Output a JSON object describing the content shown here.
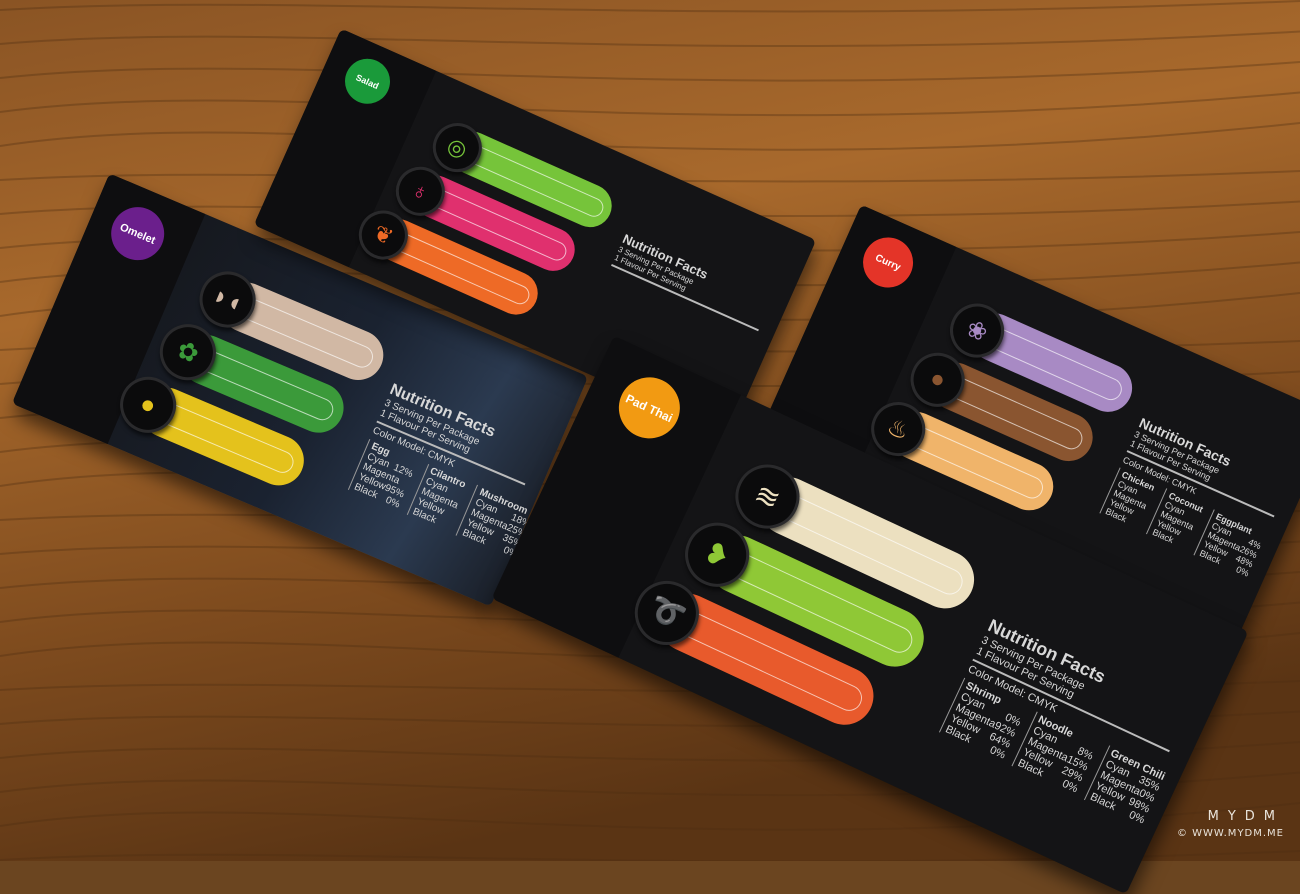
{
  "background": {
    "colors": {
      "wood_light": "#a7692e",
      "wood_mid": "#7a4a1f",
      "wood_dark": "#4a2a10"
    }
  },
  "cards": [
    {
      "id": "omelet",
      "title": "Omelet",
      "badge_color": "#6b1f8c",
      "pills": [
        {
          "color": "#d1b8a4",
          "icon": "mushroom-icon",
          "glyph": "◗◖"
        },
        {
          "color": "#3b9a3a",
          "icon": "herb-icon",
          "glyph": "✿"
        },
        {
          "color": "#e4c21c",
          "icon": "egg-icon",
          "glyph": "●"
        }
      ],
      "facts": {
        "title": "Nutrition Facts",
        "line1": "3 Serving Per Package",
        "line2": "1 Flavour Per Serving",
        "color_model": "Color Model: CMYK",
        "groups": [
          {
            "name": "Egg",
            "rows": [
              [
                "Cyan",
                "12%"
              ],
              [
                "Magenta",
                ""
              ],
              [
                "Yellow",
                "95%"
              ],
              [
                "Black",
                "0%"
              ]
            ]
          },
          {
            "name": "Cilantro",
            "rows": [
              [
                "Cyan",
                ""
              ],
              [
                "Magenta",
                ""
              ],
              [
                "Yellow",
                ""
              ],
              [
                "Black",
                ""
              ]
            ]
          },
          {
            "name": "Mushroom",
            "rows": [
              [
                "Cyan",
                "18%"
              ],
              [
                "Magenta",
                "25%"
              ],
              [
                "Yellow",
                "35%"
              ],
              [
                "Black",
                "0%"
              ]
            ]
          }
        ]
      }
    },
    {
      "id": "salad",
      "title": "Salad",
      "badge_color": "#1a9a3a",
      "pills": [
        {
          "color": "#76c43a",
          "icon": "cucumber-icon",
          "glyph": "◎"
        },
        {
          "color": "#e0306e",
          "icon": "onion-icon",
          "glyph": "♁"
        },
        {
          "color": "#ee6a26",
          "icon": "carrot-icon",
          "glyph": "❦"
        }
      ],
      "facts": {
        "title": "Nutrition Facts",
        "line1": "3 Serving Per Package",
        "line2": "1 Flavour Per Serving",
        "color_model": "",
        "groups": []
      }
    },
    {
      "id": "curry",
      "title": "Curry",
      "badge_color": "#e43428",
      "pills": [
        {
          "color": "#a88ac4",
          "icon": "eggplant-icon",
          "glyph": "❀"
        },
        {
          "color": "#8a5530",
          "icon": "egg-icon",
          "glyph": "●"
        },
        {
          "color": "#f0b46a",
          "icon": "chicken-icon",
          "glyph": "♨"
        }
      ],
      "facts": {
        "title": "Nutrition Facts",
        "line1": "3 Serving Per Package",
        "line2": "1 Flavour Per Serving",
        "color_model": "Color Model: CMYK",
        "groups": [
          {
            "name": "Chicken",
            "rows": [
              [
                "Cyan",
                ""
              ],
              [
                "Magenta",
                ""
              ],
              [
                "Yellow",
                ""
              ],
              [
                "Black",
                ""
              ]
            ]
          },
          {
            "name": "Coconut",
            "rows": [
              [
                "Cyan",
                ""
              ],
              [
                "Magenta",
                ""
              ],
              [
                "Yellow",
                ""
              ],
              [
                "Black",
                ""
              ]
            ]
          },
          {
            "name": "Eggplant",
            "rows": [
              [
                "Cyan",
                "4%"
              ],
              [
                "Magenta",
                "26%"
              ],
              [
                "Yellow",
                "48%"
              ],
              [
                "Black",
                "0%"
              ]
            ]
          }
        ]
      }
    },
    {
      "id": "pad-thai",
      "title": "Pad Thai",
      "badge_color": "#f29a12",
      "pills": [
        {
          "color": "#ece0c0",
          "icon": "noodle-icon",
          "glyph": "≋"
        },
        {
          "color": "#8fc836",
          "icon": "green-chili-icon",
          "glyph": "❥"
        },
        {
          "color": "#e85a2c",
          "icon": "shrimp-icon",
          "glyph": "➰"
        }
      ],
      "facts": {
        "title": "Nutrition Facts",
        "line1": "3 Serving Per Package",
        "line2": "1 Flavour Per Serving",
        "color_model": "Color Model: CMYK",
        "groups": [
          {
            "name": "Shrimp",
            "rows": [
              [
                "Cyan",
                "0%"
              ],
              [
                "Magenta",
                "92%"
              ],
              [
                "Yellow",
                "64%"
              ],
              [
                "Black",
                "0%"
              ]
            ]
          },
          {
            "name": "Noodle",
            "rows": [
              [
                "Cyan",
                "8%"
              ],
              [
                "Magenta",
                "15%"
              ],
              [
                "Yellow",
                "29%"
              ],
              [
                "Black",
                "0%"
              ]
            ]
          },
          {
            "name": "Green Chili",
            "rows": [
              [
                "Cyan",
                "35%"
              ],
              [
                "Magenta",
                "0%"
              ],
              [
                "Yellow",
                "98%"
              ],
              [
                "Black",
                "0%"
              ]
            ]
          }
        ]
      }
    }
  ],
  "watermark": {
    "brand": "MYDM",
    "url": "© WWW.MYDM.ME"
  }
}
